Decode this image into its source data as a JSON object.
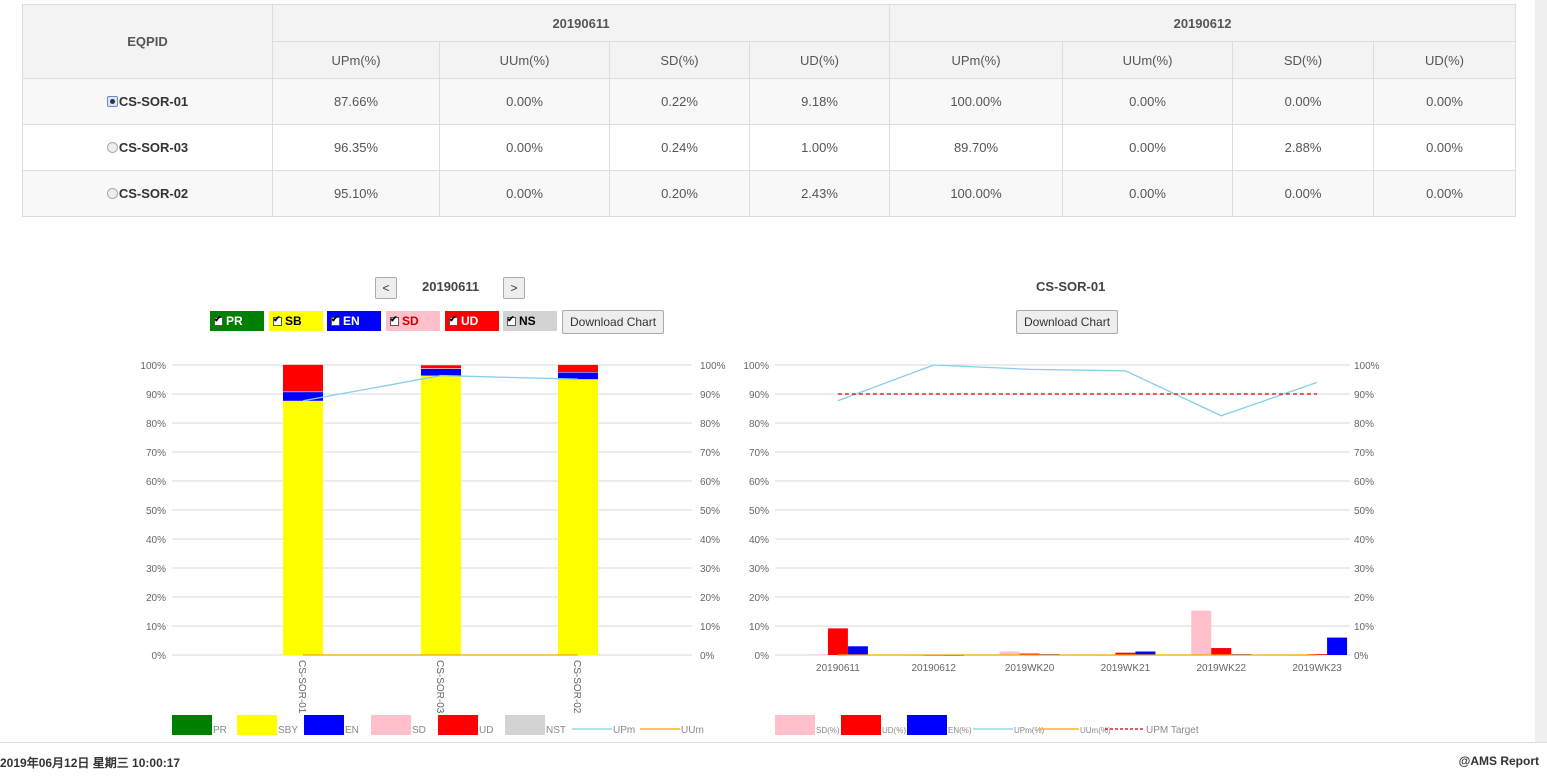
{
  "table": {
    "eq_header": "EQPID",
    "date_groups": [
      "20190611",
      "20190612"
    ],
    "sub_headers": [
      "UPm(%)",
      "UUm(%)",
      "SD(%)",
      "UD(%)",
      "UPm(%)",
      "UUm(%)",
      "SD(%)",
      "UD(%)"
    ],
    "rows": [
      {
        "eqpid": "CS-SOR-01",
        "selected": true,
        "values": [
          "87.66%",
          "0.00%",
          "0.22%",
          "9.18%",
          "100.00%",
          "0.00%",
          "0.00%",
          "0.00%"
        ]
      },
      {
        "eqpid": "CS-SOR-03",
        "selected": false,
        "values": [
          "96.35%",
          "0.00%",
          "0.24%",
          "1.00%",
          "89.70%",
          "0.00%",
          "2.88%",
          "0.00%"
        ]
      },
      {
        "eqpid": "CS-SOR-02",
        "selected": false,
        "values": [
          "95.10%",
          "0.00%",
          "0.20%",
          "2.43%",
          "100.00%",
          "0.00%",
          "0.00%",
          "0.00%"
        ]
      }
    ]
  },
  "left_panel": {
    "prev_label": "<",
    "next_label": ">",
    "date": "20190611",
    "toggles": [
      {
        "label": "PR",
        "color": "#008000",
        "text_color": "#ffffff"
      },
      {
        "label": "SB",
        "color": "#ffff00",
        "text_color": "#000000"
      },
      {
        "label": "EN",
        "color": "#0000ff",
        "text_color": "#ffffff"
      },
      {
        "label": "SD",
        "color": "#ffc0cb",
        "text_color": "#cc0000"
      },
      {
        "label": "UD",
        "color": "#ff0000",
        "text_color": "#ffffff"
      },
      {
        "label": "NS",
        "color": "#d3d3d3",
        "text_color": "#000000"
      }
    ],
    "download_label": "Download Chart"
  },
  "right_panel": {
    "title": "CS-SOR-01",
    "download_label": "Download Chart"
  },
  "chart_data": [
    {
      "type": "bar",
      "stacked": true,
      "categories": [
        "CS-SOR-01",
        "CS-SOR-03",
        "CS-SOR-02"
      ],
      "series": [
        {
          "name": "PR",
          "color": "#008000",
          "values": [
            0,
            0,
            0
          ]
        },
        {
          "name": "SBY",
          "color": "#ffff00",
          "values": [
            87.66,
            96.35,
            95.1
          ]
        },
        {
          "name": "EN",
          "color": "#0000ff",
          "values": [
            3.0,
            2.3,
            2.3
          ]
        },
        {
          "name": "SD",
          "color": "#ffc0cb",
          "values": [
            0.22,
            0.24,
            0.2
          ]
        },
        {
          "name": "UD",
          "color": "#ff0000",
          "values": [
            9.18,
            1.0,
            2.43
          ]
        },
        {
          "name": "NST",
          "color": "#d3d3d3",
          "values": [
            0,
            0,
            0
          ]
        }
      ],
      "lines": [
        {
          "name": "UPm",
          "color": "#87ceeb",
          "values": [
            87.66,
            96.35,
            95.1
          ]
        },
        {
          "name": "UUm",
          "color": "#ffa500",
          "values": [
            0,
            0,
            0
          ]
        }
      ],
      "y_ticks": [
        "0%",
        "10%",
        "20%",
        "30%",
        "40%",
        "50%",
        "60%",
        "70%",
        "80%",
        "90%",
        "100%"
      ],
      "ylim": [
        0,
        100
      ],
      "grid": true,
      "legend_position": "bottom"
    },
    {
      "type": "bar",
      "title": "CS-SOR-01",
      "categories": [
        "20190611",
        "20190612",
        "2019WK20",
        "2019WK21",
        "2019WK22",
        "2019WK23"
      ],
      "series": [
        {
          "name": "SD(%)",
          "color": "#ffc0cb",
          "values": [
            0.22,
            0.0,
            1.2,
            0.0,
            15.3,
            0.0
          ]
        },
        {
          "name": "UD(%)",
          "color": "#ff0000",
          "values": [
            9.18,
            0.0,
            0.5,
            0.8,
            2.4,
            0.3
          ]
        },
        {
          "name": "EN(%)",
          "color": "#0000ff",
          "values": [
            3.0,
            0.0,
            0.3,
            1.2,
            0.3,
            6.0
          ]
        }
      ],
      "lines": [
        {
          "name": "UPm(%)",
          "color": "#87ceeb",
          "values": [
            87.66,
            100.0,
            98.5,
            98.0,
            82.5,
            94.0
          ]
        },
        {
          "name": "UUm(%)",
          "color": "#ffa500",
          "values": [
            0,
            0,
            0,
            0,
            0,
            0
          ]
        },
        {
          "name": "UPM Target",
          "color": "#cc0000",
          "dashed": true,
          "values": [
            90,
            90,
            90,
            90,
            90,
            90
          ]
        }
      ],
      "y_ticks": [
        "0%",
        "10%",
        "20%",
        "30%",
        "40%",
        "50%",
        "60%",
        "70%",
        "80%",
        "90%",
        "100%"
      ],
      "ylim": [
        0,
        100
      ],
      "grid": true,
      "legend_position": "bottom"
    }
  ],
  "footer": {
    "datetime": "2019年06月12日 星期三 10:00:17",
    "brand": "@AMS Report"
  }
}
